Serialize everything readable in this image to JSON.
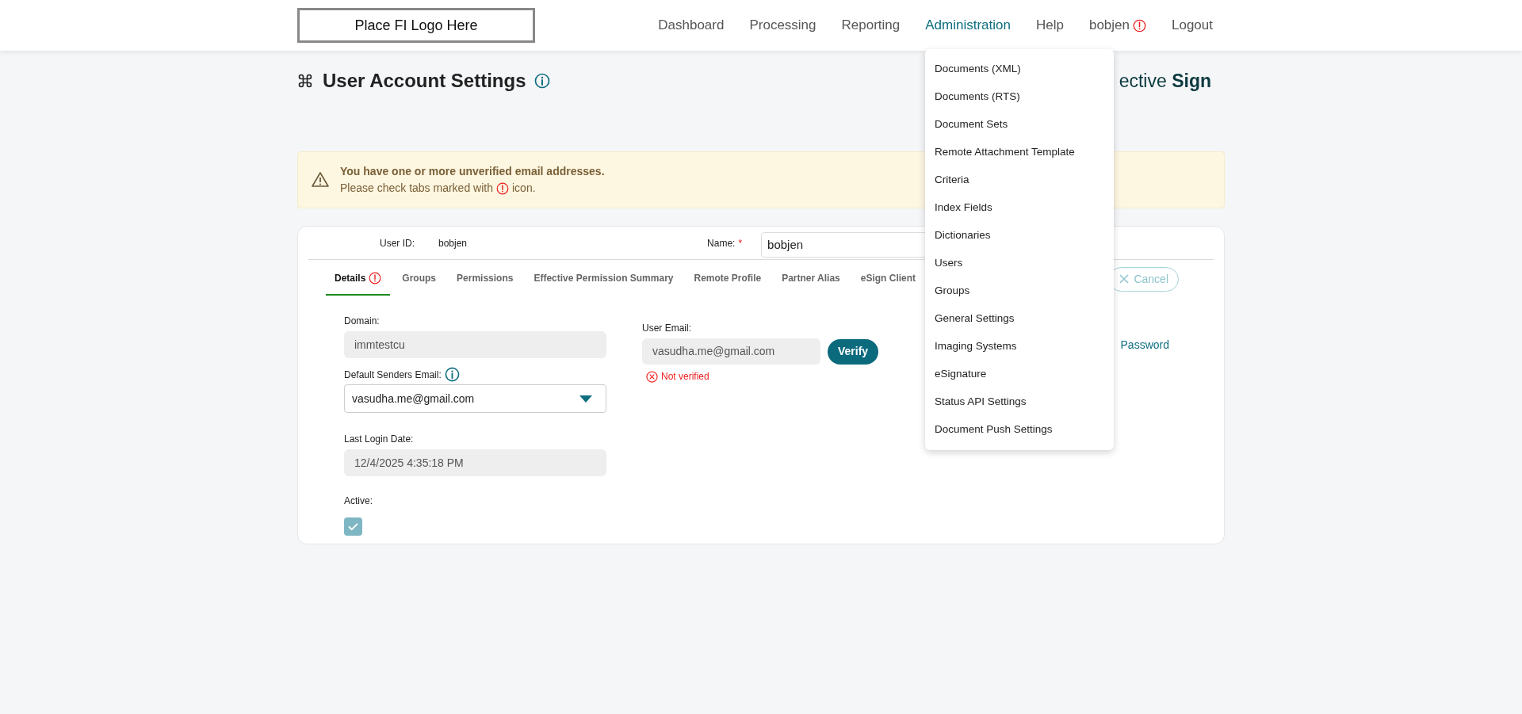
{
  "header": {
    "logo": "Place FI Logo Here",
    "nav": [
      {
        "label": "Dashboard",
        "selected": false,
        "alert": false
      },
      {
        "label": "Processing",
        "selected": false,
        "alert": false
      },
      {
        "label": "Reporting",
        "selected": false,
        "alert": false
      },
      {
        "label": "Administration",
        "selected": true,
        "alert": false
      },
      {
        "label": "Help",
        "selected": false,
        "alert": false
      },
      {
        "label": "bobjen",
        "selected": false,
        "alert": true
      },
      {
        "label": "Logout",
        "selected": false,
        "alert": false
      }
    ]
  },
  "admin_menu": [
    "Documents (XML)",
    "Documents (RTS)",
    "Document Sets",
    "Remote Attachment Template",
    "Criteria",
    "Index Fields",
    "Dictionaries",
    "Users",
    "Groups",
    "General Settings",
    "Imaging Systems",
    "eSignature",
    "Status API Settings",
    "Document Push Settings"
  ],
  "page": {
    "title": "User Account Settings",
    "brand": "ective **Sign**"
  },
  "alert": {
    "title": "You have one or more unverified email addresses.",
    "message_before": "Please check tabs marked with",
    "message_after": "icon."
  },
  "account": {
    "user_id_label": "User ID:",
    "user_id": "bobjen",
    "name_label": "Name:",
    "name_required_mark": "*",
    "name": "bobjen"
  },
  "tabs": [
    {
      "label": "Details",
      "selected": true,
      "alert": true
    },
    {
      "label": "Groups",
      "selected": false,
      "alert": false
    },
    {
      "label": "Permissions",
      "selected": false,
      "alert": false
    },
    {
      "label": "Effective Permission Summary",
      "selected": false,
      "alert": false
    },
    {
      "label": "Remote Profile",
      "selected": false,
      "alert": false
    },
    {
      "label": "Partner Alias",
      "selected": false,
      "alert": false
    },
    {
      "label": "eSign Client",
      "selected": false,
      "alert": false
    }
  ],
  "cancel_button": "Cancel",
  "details": {
    "domain_label": "Domain:",
    "domain": "immtestcu",
    "senders_label": "Default Senders Email:",
    "senders": "vasudha.me@gmail.com",
    "last_login_label": "Last Login Date:",
    "last_login": "12/4/2025 4:35:18 PM",
    "active_label": "Active:",
    "active": true,
    "email_label": "User Email:",
    "email": "vasudha.me@gmail.com",
    "verify_button": "Verify",
    "email_verified": false,
    "status": "Not verified",
    "password_link": "Password"
  }
}
